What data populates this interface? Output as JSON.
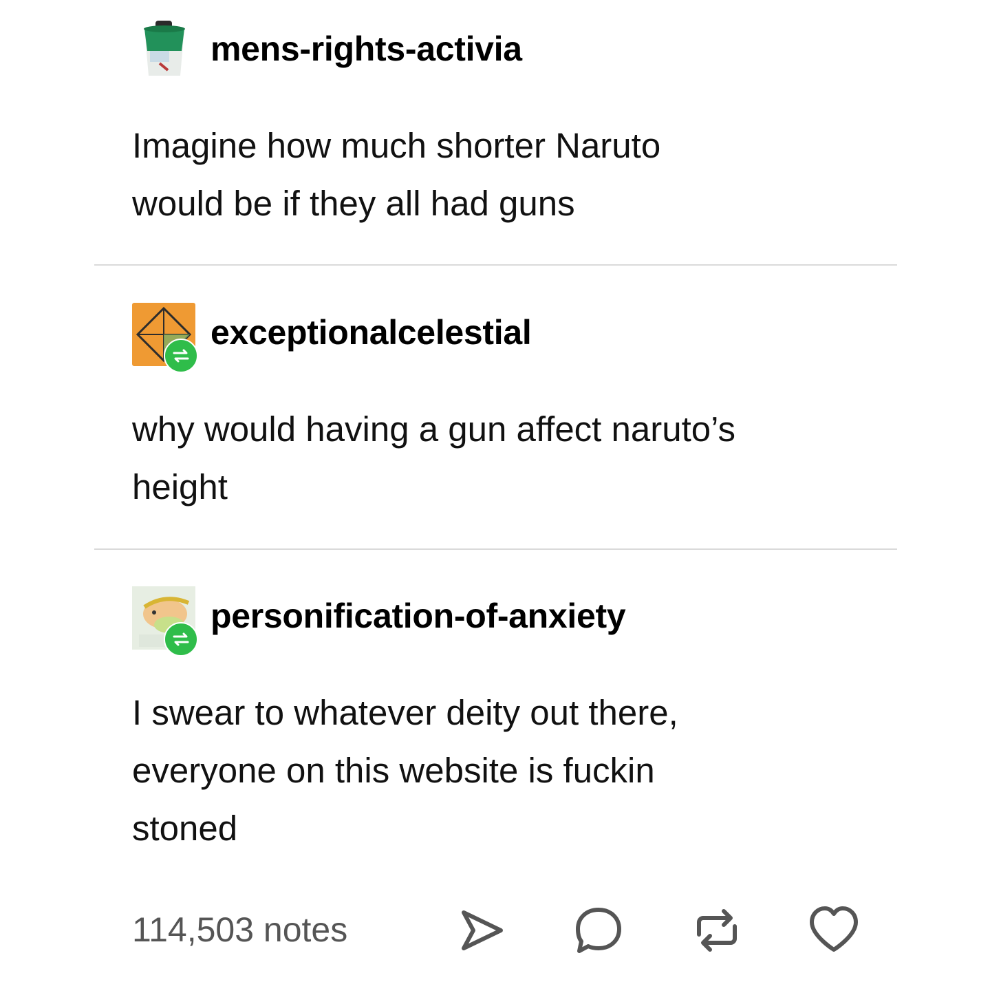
{
  "posts": [
    {
      "username": "mens-rights-activia",
      "avatar": "yogurt-cup-icon",
      "lines": [
        "Imagine how much shorter Naruto",
        "would be if they all had guns"
      ]
    },
    {
      "username": "exceptionalcelestial",
      "avatar": "orange-crystal-avatar",
      "reblog_badge": "reblog-icon",
      "lines": [
        "why would having a gun affect naruto’s",
        "height"
      ]
    },
    {
      "username": "personification-of-anxiety",
      "avatar": "cartoon-character-avatar",
      "reblog_badge": "reblog-icon",
      "lines": [
        "I swear to whatever deity out there,",
        "everyone on this website is fuckin",
        "stoned"
      ]
    }
  ],
  "footer": {
    "notes": "114,503 notes",
    "actions": [
      "share-icon",
      "comment-icon",
      "reblog-icon",
      "heart-icon"
    ]
  },
  "colors": {
    "badge_green": "#2fbd4a",
    "avatar_orange": "#ef9a33",
    "divider": "#dadada",
    "notes_gray": "#555555"
  }
}
